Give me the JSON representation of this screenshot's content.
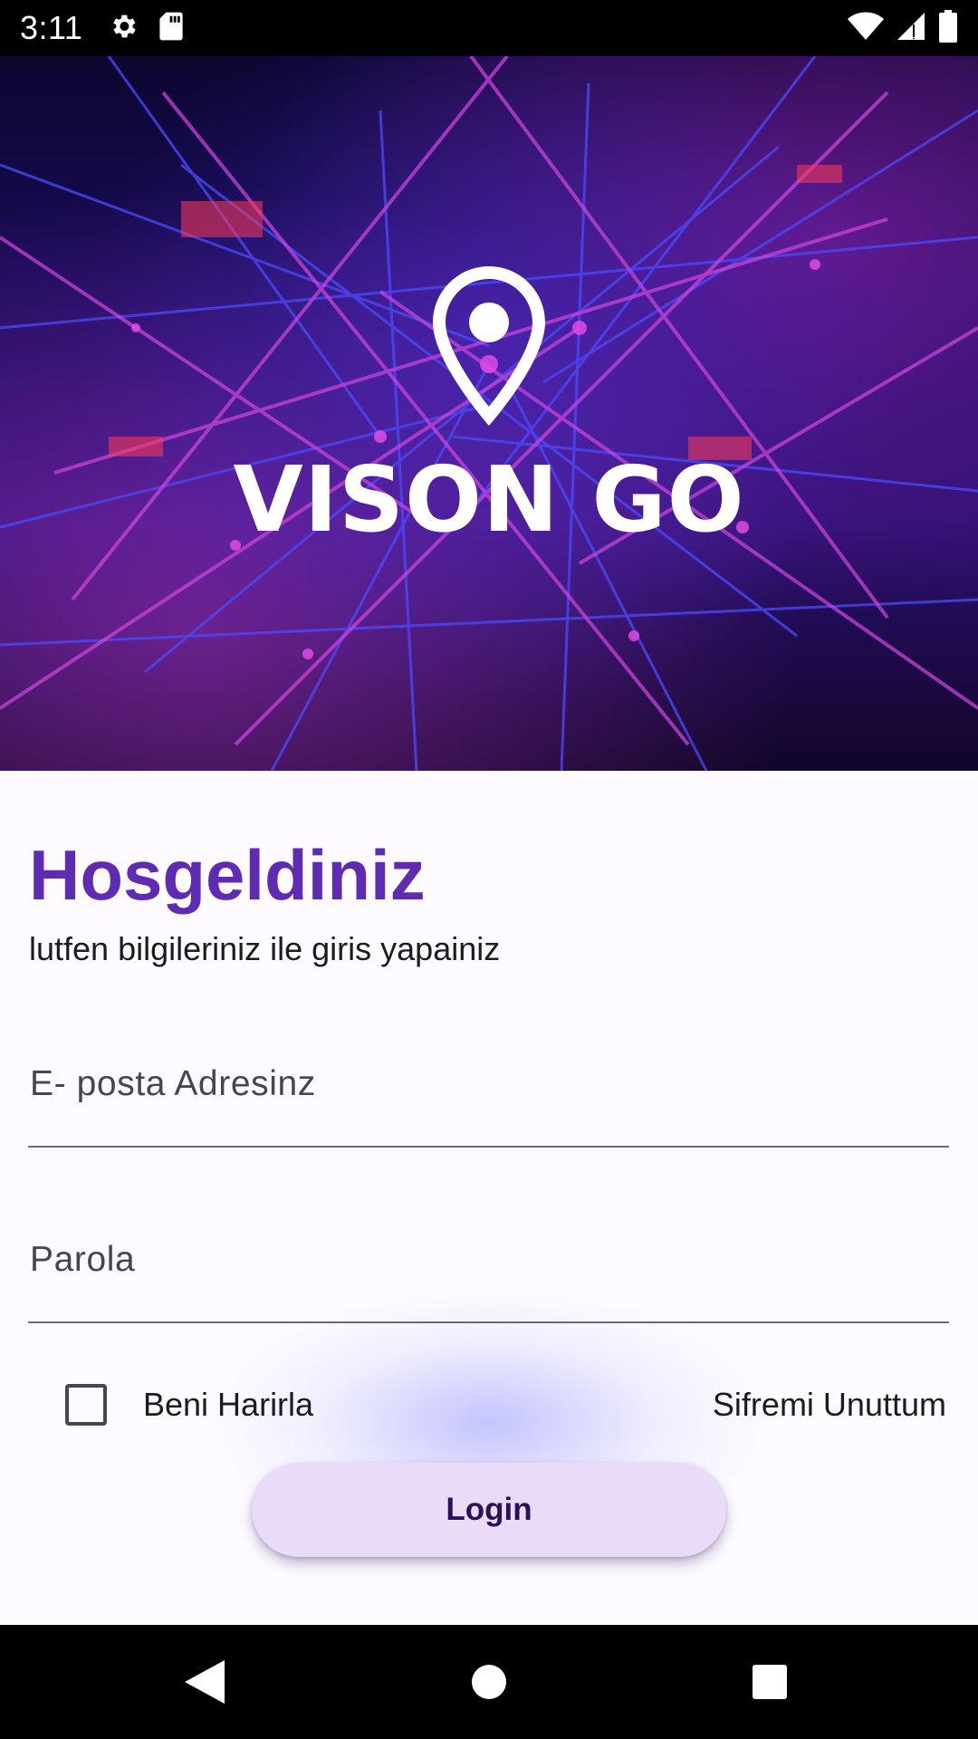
{
  "status_bar": {
    "time": "3:11",
    "left_icons": [
      "gear-icon",
      "sd-card-icon"
    ],
    "right_icons": [
      "wifi-icon",
      "signal-icon",
      "battery-icon"
    ]
  },
  "hero": {
    "brand_name": "VISON GO",
    "logo_icon": "location-pin-icon"
  },
  "login": {
    "title": "Hosgeldiniz",
    "subtitle": "lutfen bilgileriniz ile giris yapainiz",
    "email_placeholder": "E- posta Adresinz",
    "email_value": "",
    "password_placeholder": "Parola",
    "password_value": "",
    "remember_label": "Beni Harirla",
    "remember_checked": false,
    "forgot_label": "Sifremi Unuttum",
    "login_label": "Login"
  },
  "colors": {
    "accent": "#5f2bb3",
    "button_bg": "#eadcf9",
    "button_text": "#2b1258"
  },
  "nav_bar": {
    "icons": [
      "back-icon",
      "home-icon",
      "recents-icon"
    ]
  }
}
